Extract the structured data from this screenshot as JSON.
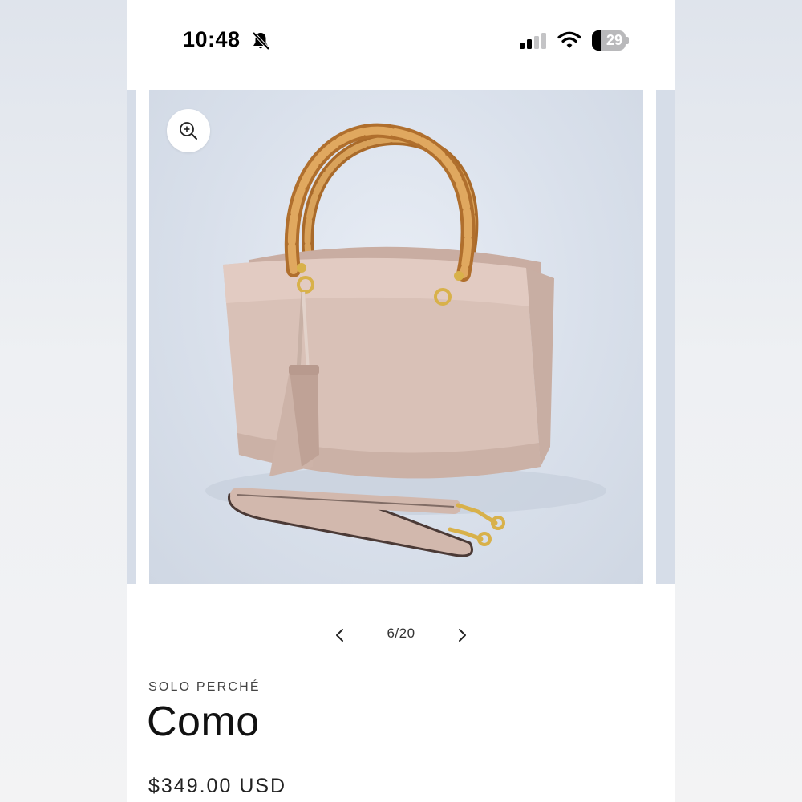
{
  "status_bar": {
    "time": "10:48",
    "battery_percent": 29,
    "battery_label": "29",
    "icons": [
      "bell-slash-icon",
      "signal-icon",
      "wifi-icon",
      "battery-icon"
    ]
  },
  "carousel": {
    "image_subject": "taupe leather handbag with bamboo handles, tassel and shoulder strap",
    "zoom_icon": "zoom-in-icon",
    "current": 6,
    "total": 20,
    "counter_text": "6/20",
    "prev_icon": "chevron-left-icon",
    "next_icon": "chevron-right-icon"
  },
  "product": {
    "vendor": "SOLO PERCHÉ",
    "title": "Como",
    "price": "$349.00 USD"
  },
  "colors": {
    "photo_background": "#d9e0eb",
    "bag": "#d8c0b6",
    "bamboo": "#c7893c",
    "hardware": "#d8b14a"
  }
}
